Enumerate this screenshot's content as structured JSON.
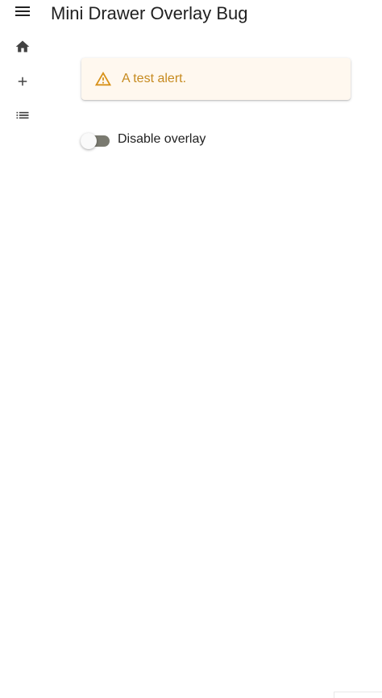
{
  "app": {
    "title": "Mini Drawer Overlay Bug"
  },
  "header": {
    "menu_icon": "menu-icon"
  },
  "drawer": {
    "items": [
      {
        "icon": "home-icon"
      },
      {
        "icon": "add-icon"
      },
      {
        "icon": "list-icon"
      }
    ]
  },
  "alert": {
    "severity": "warning",
    "icon": "warning-icon",
    "text": "A test alert.",
    "color": "#c68a1f",
    "background": "#fff8ef"
  },
  "overlay_switch": {
    "label": "Disable overlay",
    "checked": false
  }
}
